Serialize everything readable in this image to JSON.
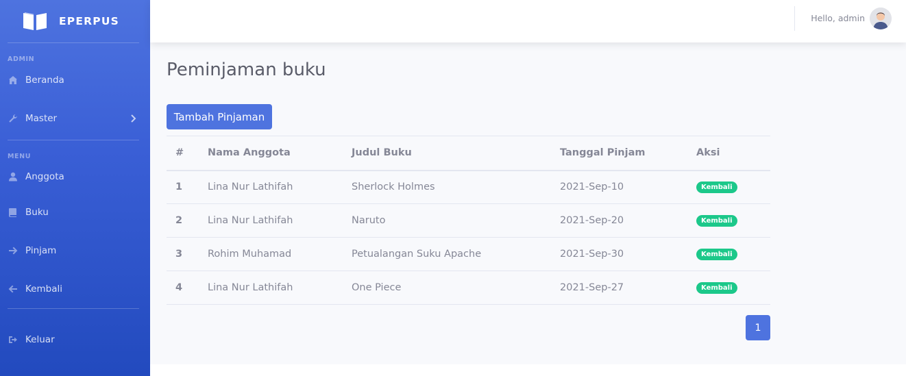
{
  "brand": {
    "name": "EPERPUS",
    "logo_icon": "open-book-icon"
  },
  "sidebar": {
    "admin_heading": "ADMIN",
    "menu_heading": "MENU",
    "items": [
      {
        "label": "Beranda",
        "icon": "home-icon"
      },
      {
        "label": "Master",
        "icon": "wrench-icon"
      },
      {
        "label": "Anggota",
        "icon": "user-icon"
      },
      {
        "label": "Buku",
        "icon": "book-icon"
      },
      {
        "label": "Pinjam",
        "icon": "arrow-right-icon"
      },
      {
        "label": "Kembali",
        "icon": "arrow-left-icon"
      },
      {
        "label": "Keluar",
        "icon": "sign-out-icon"
      }
    ]
  },
  "topbar": {
    "greeting": "Hello, admin"
  },
  "main": {
    "title": "Peminjaman buku",
    "add_button": "Tambah Pinjaman",
    "table": {
      "headers": [
        "#",
        "Nama Anggota",
        "Judul Buku",
        "Tanggal Pinjam",
        "Aksi"
      ],
      "rows": [
        {
          "no": "1",
          "member": "Lina Nur Lathifah",
          "book": "Sherlock Holmes",
          "date": "2021-Sep-10",
          "action": "Kembali"
        },
        {
          "no": "2",
          "member": "Lina Nur Lathifah",
          "book": "Naruto",
          "date": "2021-Sep-20",
          "action": "Kembali"
        },
        {
          "no": "3",
          "member": "Rohim Muhamad",
          "book": "Petualangan Suku Apache",
          "date": "2021-Sep-30",
          "action": "Kembali"
        },
        {
          "no": "4",
          "member": "Lina Nur Lathifah",
          "book": "One Piece",
          "date": "2021-Sep-27",
          "action": "Kembali"
        }
      ]
    },
    "pagination": {
      "current": "1"
    }
  },
  "colors": {
    "primary": "#4e73df",
    "success": "#1cc88a",
    "text": "#858796",
    "title": "#5a5c69"
  }
}
